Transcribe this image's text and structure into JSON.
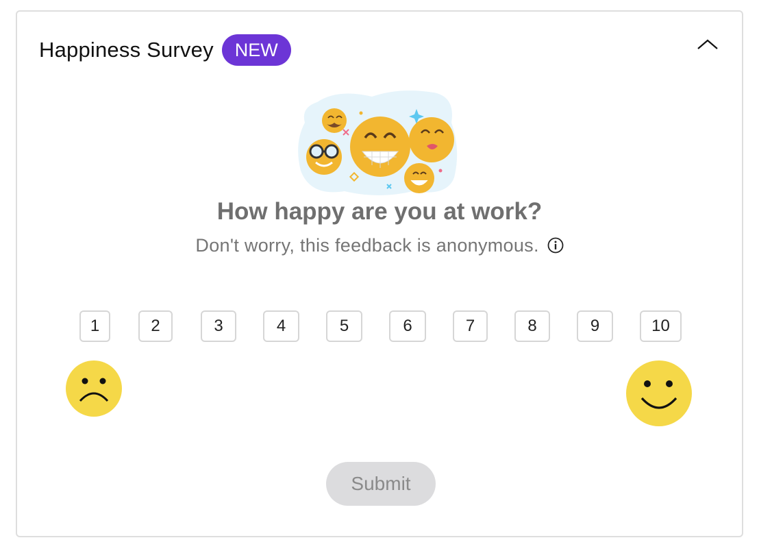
{
  "survey": {
    "title": "Happiness Survey",
    "badge": "NEW",
    "collapse_icon": "chevron-up-icon",
    "question": "How happy are you at work?",
    "subtitle": "Don't worry, this feedback is anonymous.",
    "info_icon": "info-icon",
    "scale": [
      "1",
      "2",
      "3",
      "4",
      "5",
      "6",
      "7",
      "8",
      "9",
      "10"
    ],
    "low_face_icon": "sad-face-icon",
    "high_face_icon": "happy-face-icon",
    "submit_label": "Submit",
    "colors": {
      "badge": "#6c35d6",
      "face": "#f5d848",
      "submit_bg": "#dcdcde",
      "question": "#6f6f6f"
    }
  }
}
